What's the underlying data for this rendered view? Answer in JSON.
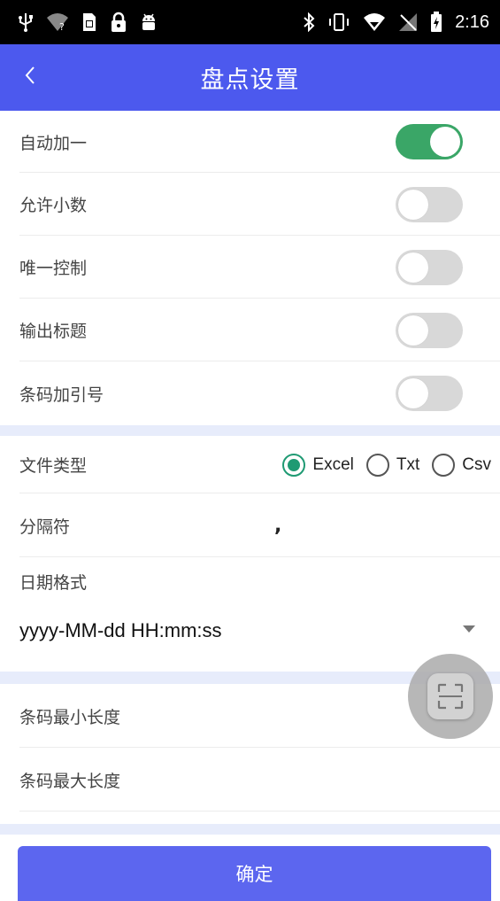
{
  "status_bar": {
    "time": "2:16",
    "left_icons": [
      "usb-icon",
      "wifi-question-icon",
      "sim-card-icon",
      "lock-icon",
      "android-icon"
    ],
    "right_icons": [
      "bluetooth-icon",
      "vibrate-icon",
      "wifi-signal-icon",
      "no-signal-icon",
      "battery-charging-icon"
    ]
  },
  "header": {
    "title": "盘点设置",
    "back_icon": "chevron-left-icon",
    "background": "#4c59ee"
  },
  "settings": {
    "toggles": [
      {
        "label": "自动加一",
        "on": true
      },
      {
        "label": "允许小数",
        "on": false
      },
      {
        "label": "唯一控制",
        "on": false
      },
      {
        "label": "输出标题",
        "on": false
      },
      {
        "label": "条码加引号",
        "on": false
      }
    ],
    "file_type": {
      "label": "文件类型",
      "options": [
        "Excel",
        "Txt",
        "Csv"
      ],
      "selected": "Excel"
    },
    "separator": {
      "label": "分隔符",
      "value": ","
    },
    "date_format": {
      "label": "日期格式",
      "value": "yyyy-MM-dd HH:mm:ss"
    },
    "barcode_min_length": {
      "label": "条码最小长度",
      "value": ""
    },
    "barcode_max_length": {
      "label": "条码最大长度",
      "value": ""
    }
  },
  "scan_button": {
    "icon": "scan-icon"
  },
  "footer": {
    "confirm_label": "确定",
    "button_color": "#5c66ef"
  },
  "colors": {
    "toggle_on": "#3aa667",
    "toggle_off": "#d8d8d8",
    "radio_checked": "#1f9a73",
    "section_gap": "#e7ecfb"
  }
}
